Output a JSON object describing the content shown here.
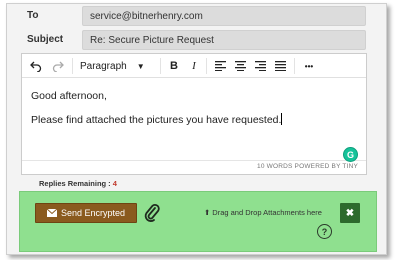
{
  "header": {
    "to_label": "To",
    "to_value": "service@bitnerhenry.com",
    "subject_label": "Subject",
    "subject_value": "Re: Secure Picture Request"
  },
  "toolbar": {
    "format_value": "Paragraph",
    "bold": "B",
    "italic": "I",
    "more": "•••"
  },
  "editor": {
    "greeting": "Good afternoon,",
    "body": "Please find attached the pictures you have requested.",
    "word_count": "10 WORDS  POWERED BY TINY",
    "grammarly": "G"
  },
  "replies": {
    "label": "Replies Remaining :",
    "count": "4"
  },
  "actions": {
    "send_label": "Send Encrypted",
    "drop_label": "Drag and Drop Attachments here",
    "close_label": "✖",
    "help_label": "?"
  },
  "colors": {
    "drop_zone": "#8fe08f",
    "send_button": "#8a5a1e",
    "close_button": "#2d6a2d",
    "grammarly": "#15c39a"
  }
}
